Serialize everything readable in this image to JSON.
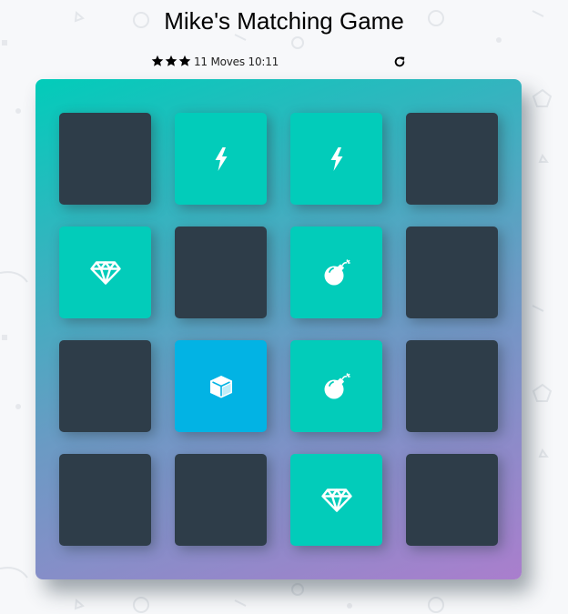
{
  "header": {
    "title": "Mike's Matching Game"
  },
  "score_panel": {
    "stars_total": 3,
    "stars_filled": 3,
    "moves_and_time": "11 Moves 10:11",
    "restart_icon": "restart-icon"
  },
  "colors": {
    "card_back": "#2e3d49",
    "card_match": "#02ccba",
    "card_open": "#02b3e4",
    "deck_gradient_start": "#02ccba",
    "deck_gradient_end": "#aa7ecd"
  },
  "deck": {
    "columns": 4,
    "rows": 4,
    "cards": [
      {
        "state": "closed",
        "icon": ""
      },
      {
        "state": "match",
        "icon": "bolt-icon"
      },
      {
        "state": "match",
        "icon": "bolt-icon"
      },
      {
        "state": "closed",
        "icon": ""
      },
      {
        "state": "match",
        "icon": "diamond-icon"
      },
      {
        "state": "closed",
        "icon": ""
      },
      {
        "state": "match",
        "icon": "bomb-icon"
      },
      {
        "state": "closed",
        "icon": ""
      },
      {
        "state": "closed",
        "icon": ""
      },
      {
        "state": "open",
        "icon": "cube-icon"
      },
      {
        "state": "match",
        "icon": "bomb-icon"
      },
      {
        "state": "closed",
        "icon": ""
      },
      {
        "state": "closed",
        "icon": ""
      },
      {
        "state": "closed",
        "icon": ""
      },
      {
        "state": "match",
        "icon": "diamond-icon"
      },
      {
        "state": "closed",
        "icon": ""
      }
    ]
  }
}
